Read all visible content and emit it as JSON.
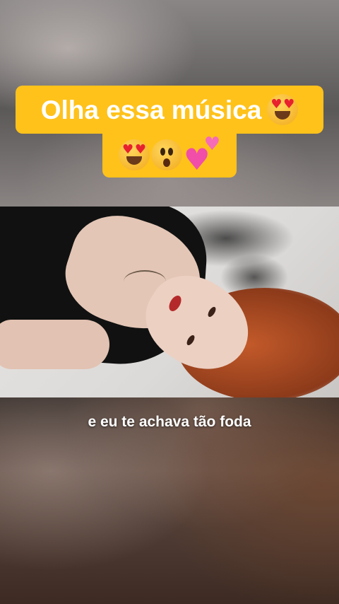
{
  "caption": {
    "line1_text": "Olha essa música",
    "line1_emojis": [
      "smiling-face-with-heart-eyes-icon"
    ],
    "line2_emojis": [
      "smiling-face-with-heart-eyes-icon",
      "astonished-face-icon",
      "two-hearts-icon"
    ],
    "background_color": "#ffc21a",
    "text_color": "#ffffff"
  },
  "video": {
    "subtitle": "e eu te achava tão foda"
  }
}
